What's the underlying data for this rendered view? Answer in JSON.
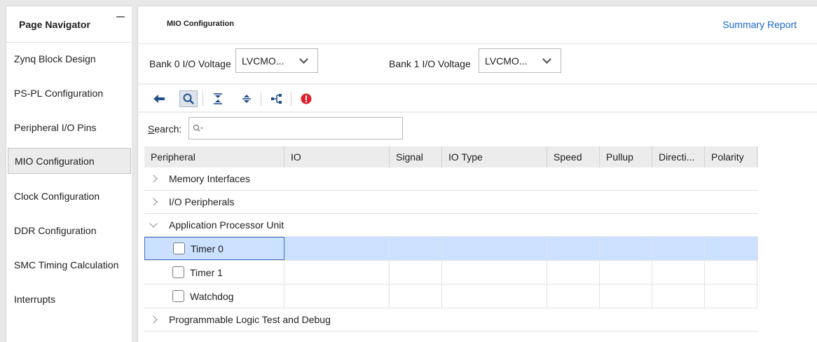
{
  "navigator": {
    "title": "Page Navigator",
    "items": [
      {
        "label": "Zynq Block Design"
      },
      {
        "label": "PS-PL Configuration"
      },
      {
        "label": "Peripheral I/O Pins"
      },
      {
        "label": "MIO Configuration",
        "active": true
      },
      {
        "label": "Clock Configuration"
      },
      {
        "label": "DDR Configuration"
      },
      {
        "label": "SMC Timing Calculation"
      },
      {
        "label": "Interrupts"
      }
    ]
  },
  "main": {
    "title": "MIO Configuration",
    "summary_link": "Summary Report",
    "bank0": {
      "label": "Bank 0 I/O Voltage",
      "value": "LVCMO..."
    },
    "bank1": {
      "label": "Bank 1 I/O Voltage",
      "value": "LVCMO..."
    },
    "search": {
      "label_prefix": "S",
      "label_rest": "earch:",
      "value": ""
    }
  },
  "table": {
    "columns": [
      "Peripheral",
      "IO",
      "Signal",
      "IO Type",
      "Speed",
      "Pullup",
      "Directi...",
      "Polarity"
    ],
    "groups": [
      {
        "label": "Memory Interfaces",
        "expanded": false
      },
      {
        "label": "I/O Peripherals",
        "expanded": false
      },
      {
        "label": "Application Processor Unit",
        "expanded": true
      },
      {
        "label": "Programmable Logic Test and Debug",
        "expanded": false
      }
    ],
    "apu_children": [
      {
        "label": "Timer 0",
        "checked": false,
        "selected": true
      },
      {
        "label": "Timer 1",
        "checked": false
      },
      {
        "label": "Watchdog",
        "checked": false
      }
    ]
  },
  "colors": {
    "link": "#1a66cc",
    "selection": "#cce0ff",
    "error": "#e0202a",
    "toolbar_icon": "#1f4e8c"
  }
}
